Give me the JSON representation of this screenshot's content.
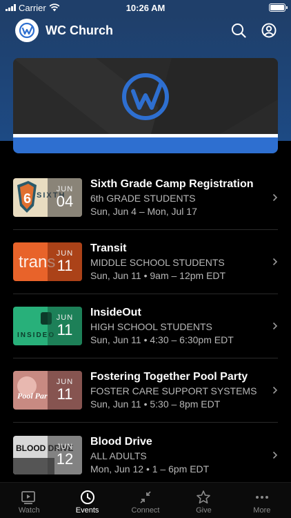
{
  "status": {
    "carrier": "Carrier",
    "time": "10:26 AM"
  },
  "header": {
    "title": "WC Church"
  },
  "colors": {
    "brand_blue": "#2e6fd0",
    "header_blue": "#1f3f6a",
    "background": "#000000"
  },
  "events": [
    {
      "title": "Sixth Grade Camp Registration",
      "subtitle": "6th GRADE STUDENTS",
      "time": "Sun, Jun 4 – Mon, Jul 17",
      "month": "JUN",
      "day": "04",
      "thumb_text": "SIXTH"
    },
    {
      "title": "Transit",
      "subtitle": "MIDDLE SCHOOL STUDENTS",
      "time": "Sun, Jun 11 • 9am – 12pm EDT",
      "month": "JUN",
      "day": "11",
      "thumb_text": "trans"
    },
    {
      "title": "InsideOut",
      "subtitle": "HIGH SCHOOL STUDENTS",
      "time": "Sun, Jun 11 • 4:30 – 6:30pm EDT",
      "month": "JUN",
      "day": "11",
      "thumb_text": "INSIDEO"
    },
    {
      "title": "Fostering Together Pool Party",
      "subtitle": "FOSTER CARE SUPPORT SYSTEMS",
      "time": "Sun, Jun 11 • 5:30 – 8pm EDT",
      "month": "JUN",
      "day": "11",
      "thumb_text": "Pool Par"
    },
    {
      "title": "Blood Drive",
      "subtitle": "ALL ADULTS",
      "time": "Mon, Jun 12 • 1 – 6pm EDT",
      "month": "JUN",
      "day": "12",
      "thumb_text": "BLOOD DRIVE"
    }
  ],
  "tabs": [
    {
      "label": "Watch",
      "icon": "play-video-icon"
    },
    {
      "label": "Events",
      "icon": "clock-icon"
    },
    {
      "label": "Connect",
      "icon": "connect-arrows-icon"
    },
    {
      "label": "Give",
      "icon": "star-icon"
    },
    {
      "label": "More",
      "icon": "more-dots-icon"
    }
  ]
}
